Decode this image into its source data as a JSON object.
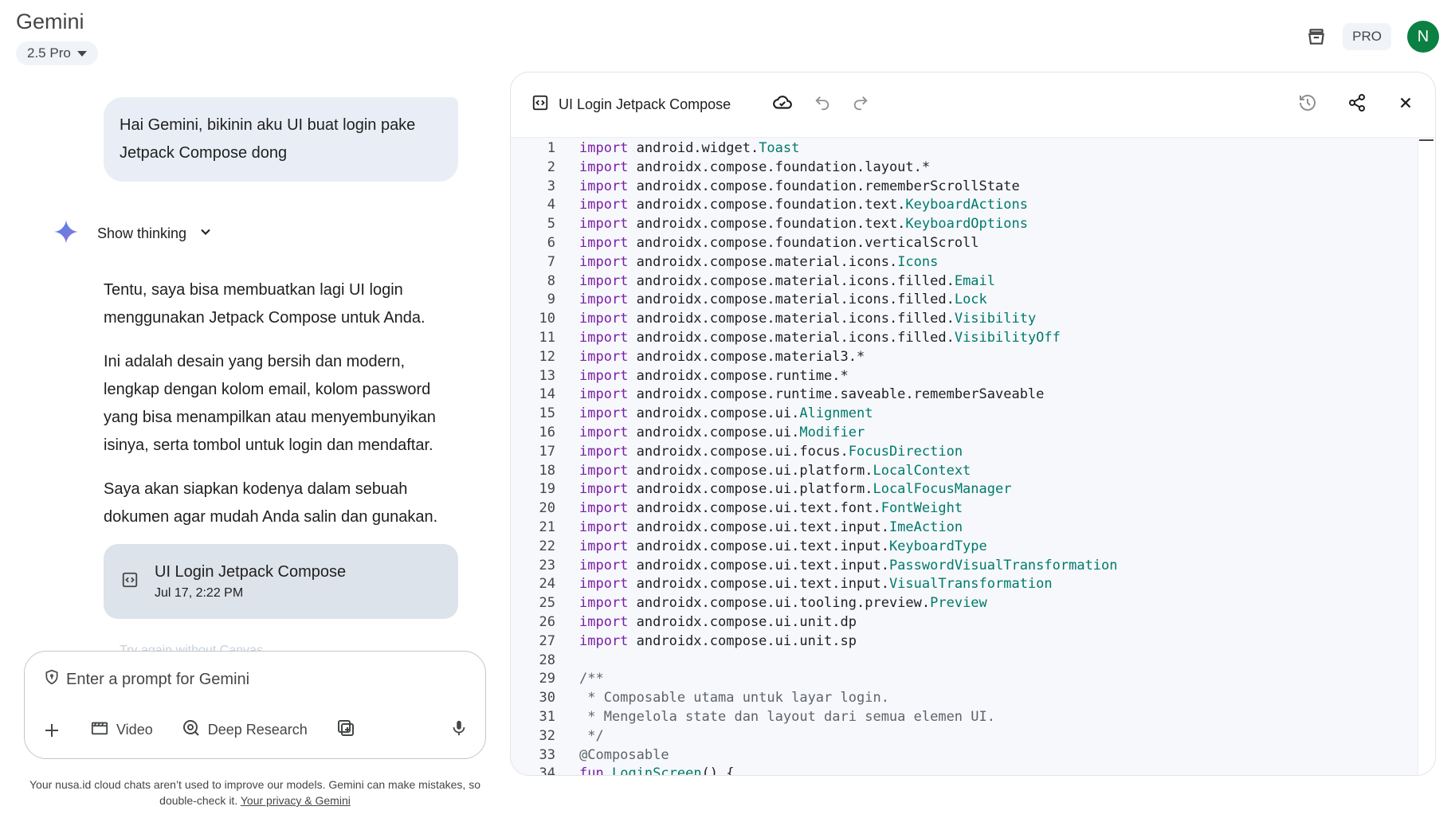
{
  "app": {
    "brand": "Gemini",
    "model": "2.5 Pro",
    "pro_badge": "PRO",
    "avatar_letter": "N"
  },
  "chat": {
    "user_message": "Hai Gemini, bikinin aku UI buat login pake Jetpack Compose dong",
    "show_thinking": "Show thinking",
    "response_paragraphs": [
      "Tentu, saya bisa membuatkan lagi UI login menggunakan Jetpack Compose untuk Anda.",
      "Ini adalah desain yang bersih dan modern, lengkap dengan kolom email, kolom password yang bisa menampilkan atau menyembunyikan isinya, serta tombol untuk login dan mendaftar.",
      "Saya akan siapkan kodenya dalam sebuah dokumen agar mudah Anda salin dan gunakan."
    ],
    "doc_card": {
      "title": "UI Login Jetpack Compose",
      "date": "Jul 17, 2:22 PM"
    },
    "faded_text": "Try again without Canvas"
  },
  "prompt": {
    "placeholder": "Enter a prompt for Gemini",
    "tools": {
      "video": "Video",
      "deep_research": "Deep Research"
    }
  },
  "disclaimer": {
    "text": "Your nusa.id cloud chats aren’t used to improve our models. Gemini can make mistakes, so double-check it.",
    "link": "Your privacy & Gemini"
  },
  "canvas": {
    "title": "UI Login Jetpack Compose",
    "code_lines": [
      [
        [
          "kw",
          "import"
        ],
        [
          "p",
          " android.widget."
        ],
        [
          "ty",
          "Toast"
        ]
      ],
      [
        [
          "kw",
          "import"
        ],
        [
          "p",
          " androidx.compose.foundation.layout.*"
        ]
      ],
      [
        [
          "kw",
          "import"
        ],
        [
          "p",
          " androidx.compose.foundation.rememberScrollState"
        ]
      ],
      [
        [
          "kw",
          "import"
        ],
        [
          "p",
          " androidx.compose.foundation.text."
        ],
        [
          "ty",
          "KeyboardActions"
        ]
      ],
      [
        [
          "kw",
          "import"
        ],
        [
          "p",
          " androidx.compose.foundation.text."
        ],
        [
          "ty",
          "KeyboardOptions"
        ]
      ],
      [
        [
          "kw",
          "import"
        ],
        [
          "p",
          " androidx.compose.foundation.verticalScroll"
        ]
      ],
      [
        [
          "kw",
          "import"
        ],
        [
          "p",
          " androidx.compose.material.icons."
        ],
        [
          "ty",
          "Icons"
        ]
      ],
      [
        [
          "kw",
          "import"
        ],
        [
          "p",
          " androidx.compose.material.icons.filled."
        ],
        [
          "ty",
          "Email"
        ]
      ],
      [
        [
          "kw",
          "import"
        ],
        [
          "p",
          " androidx.compose.material.icons.filled."
        ],
        [
          "ty",
          "Lock"
        ]
      ],
      [
        [
          "kw",
          "import"
        ],
        [
          "p",
          " androidx.compose.material.icons.filled."
        ],
        [
          "ty",
          "Visibility"
        ]
      ],
      [
        [
          "kw",
          "import"
        ],
        [
          "p",
          " androidx.compose.material.icons.filled."
        ],
        [
          "ty",
          "VisibilityOff"
        ]
      ],
      [
        [
          "kw",
          "import"
        ],
        [
          "p",
          " androidx.compose.material3.*"
        ]
      ],
      [
        [
          "kw",
          "import"
        ],
        [
          "p",
          " androidx.compose.runtime.*"
        ]
      ],
      [
        [
          "kw",
          "import"
        ],
        [
          "p",
          " androidx.compose.runtime.saveable.rememberSaveable"
        ]
      ],
      [
        [
          "kw",
          "import"
        ],
        [
          "p",
          " androidx.compose.ui."
        ],
        [
          "ty",
          "Alignment"
        ]
      ],
      [
        [
          "kw",
          "import"
        ],
        [
          "p",
          " androidx.compose.ui."
        ],
        [
          "ty",
          "Modifier"
        ]
      ],
      [
        [
          "kw",
          "import"
        ],
        [
          "p",
          " androidx.compose.ui.focus."
        ],
        [
          "ty",
          "FocusDirection"
        ]
      ],
      [
        [
          "kw",
          "import"
        ],
        [
          "p",
          " androidx.compose.ui.platform."
        ],
        [
          "ty",
          "LocalContext"
        ]
      ],
      [
        [
          "kw",
          "import"
        ],
        [
          "p",
          " androidx.compose.ui.platform."
        ],
        [
          "ty",
          "LocalFocusManager"
        ]
      ],
      [
        [
          "kw",
          "import"
        ],
        [
          "p",
          " androidx.compose.ui.text.font."
        ],
        [
          "ty",
          "FontWeight"
        ]
      ],
      [
        [
          "kw",
          "import"
        ],
        [
          "p",
          " androidx.compose.ui.text.input."
        ],
        [
          "ty",
          "ImeAction"
        ]
      ],
      [
        [
          "kw",
          "import"
        ],
        [
          "p",
          " androidx.compose.ui.text.input."
        ],
        [
          "ty",
          "KeyboardType"
        ]
      ],
      [
        [
          "kw",
          "import"
        ],
        [
          "p",
          " androidx.compose.ui.text.input."
        ],
        [
          "ty",
          "PasswordVisualTransformation"
        ]
      ],
      [
        [
          "kw",
          "import"
        ],
        [
          "p",
          " androidx.compose.ui.text.input."
        ],
        [
          "ty",
          "VisualTransformation"
        ]
      ],
      [
        [
          "kw",
          "import"
        ],
        [
          "p",
          " androidx.compose.ui.tooling.preview."
        ],
        [
          "ty",
          "Preview"
        ]
      ],
      [
        [
          "kw",
          "import"
        ],
        [
          "p",
          " androidx.compose.ui.unit.dp"
        ]
      ],
      [
        [
          "kw",
          "import"
        ],
        [
          "p",
          " androidx.compose.ui.unit.sp"
        ]
      ],
      [
        [
          "p",
          ""
        ]
      ],
      [
        [
          "cm",
          "/**"
        ]
      ],
      [
        [
          "cm",
          " * Composable utama untuk layar login."
        ]
      ],
      [
        [
          "cm",
          " * Mengelola state dan layout dari semua elemen UI."
        ]
      ],
      [
        [
          "cm",
          " */"
        ]
      ],
      [
        [
          "an",
          "@Composable"
        ]
      ],
      [
        [
          "kw",
          "fun"
        ],
        [
          "p",
          " "
        ],
        [
          "fn",
          "LoginScreen"
        ],
        [
          "p",
          "() {"
        ]
      ]
    ]
  },
  "colors": {
    "accent": "#0b57d0",
    "avatar_bg": "#0b8043",
    "keyword": "#7b1fa2",
    "type": "#00796b"
  }
}
